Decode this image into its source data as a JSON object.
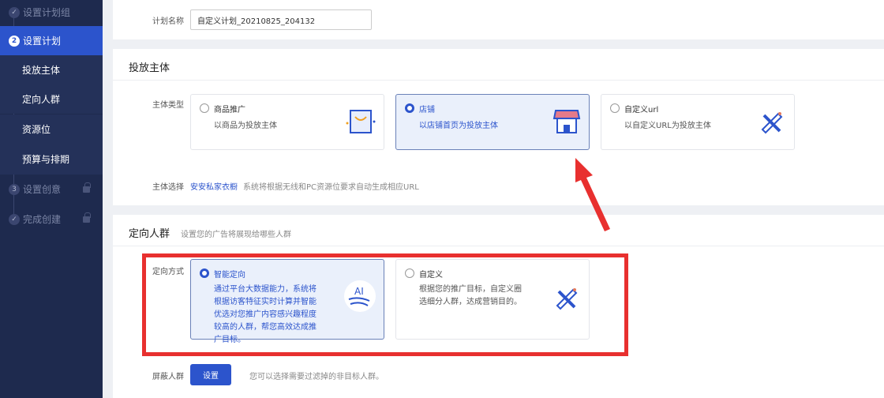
{
  "sidebar": {
    "items": [
      {
        "label": "设置计划组",
        "marker": "✓",
        "state": "done"
      },
      {
        "label": "设置计划",
        "marker": "2",
        "state": "active"
      },
      {
        "label": "投放主体"
      },
      {
        "label": "定向人群"
      },
      {
        "label": "资源位"
      },
      {
        "label": "预算与排期"
      },
      {
        "label": "设置创意",
        "marker": "3",
        "state": "locked"
      },
      {
        "label": "完成创建",
        "marker": "✓",
        "state": "locked"
      }
    ]
  },
  "plan": {
    "name_label": "计划名称",
    "name_value": "自定义计划_20210825_204132"
  },
  "subject": {
    "title": "投放主体",
    "type_label": "主体类型",
    "options": [
      {
        "title": "商品推广",
        "desc": "以商品为投放主体",
        "icon": "shopping-bag-icon",
        "selected": false
      },
      {
        "title": "店铺",
        "desc": "以店铺首页为投放主体",
        "icon": "store-icon",
        "selected": true
      },
      {
        "title": "自定义url",
        "desc": "以自定义URL为投放主体",
        "icon": "pencil-ruler-icon",
        "selected": false
      }
    ],
    "select_label": "主体选择",
    "select_value": "安安私家衣橱",
    "select_hint": "系统将根据无线和PC资源位要求自动生成相应URL"
  },
  "audience": {
    "title": "定向人群",
    "subtitle": "设置您的广告将展现给哪些人群",
    "mode_label": "定向方式",
    "options": [
      {
        "title": "智能定向",
        "desc": "通过平台大数据能力，系统将根据访客特征实时计算并智能优选对您推广内容感兴趣程度较高的人群，帮您高效达成推广目标。",
        "icon": "ai-hand-icon",
        "icon_text": "AI",
        "selected": true
      },
      {
        "title": "自定义",
        "desc": "根据您的推广目标，自定义圈选细分人群，达成营销目的。",
        "icon": "pencil-ruler-icon",
        "selected": false
      }
    ],
    "block_label": "屏蔽人群",
    "block_button": "设置",
    "block_hint": "您可以选择需要过滤掉的非目标人群。"
  },
  "colors": {
    "accent": "#2c54cc",
    "sidebar": "#1e2a4e",
    "annotation": "#e8302f"
  }
}
